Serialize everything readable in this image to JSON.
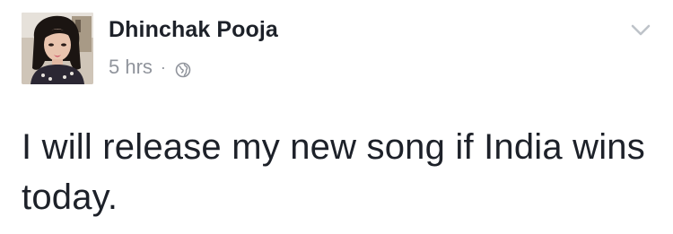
{
  "post": {
    "author_name": "Dhinchak Pooja",
    "timestamp": "5 hrs",
    "separator": "·",
    "audience_icon": "globe-icon",
    "menu_icon": "chevron-down-icon",
    "avatar_icon": "profile-photo",
    "text": "I will release my new song if India wins today."
  },
  "colors": {
    "name": "#1d2129",
    "meta": "#90949c",
    "body_text": "#1d2129",
    "chevron": "#bec3c9"
  }
}
